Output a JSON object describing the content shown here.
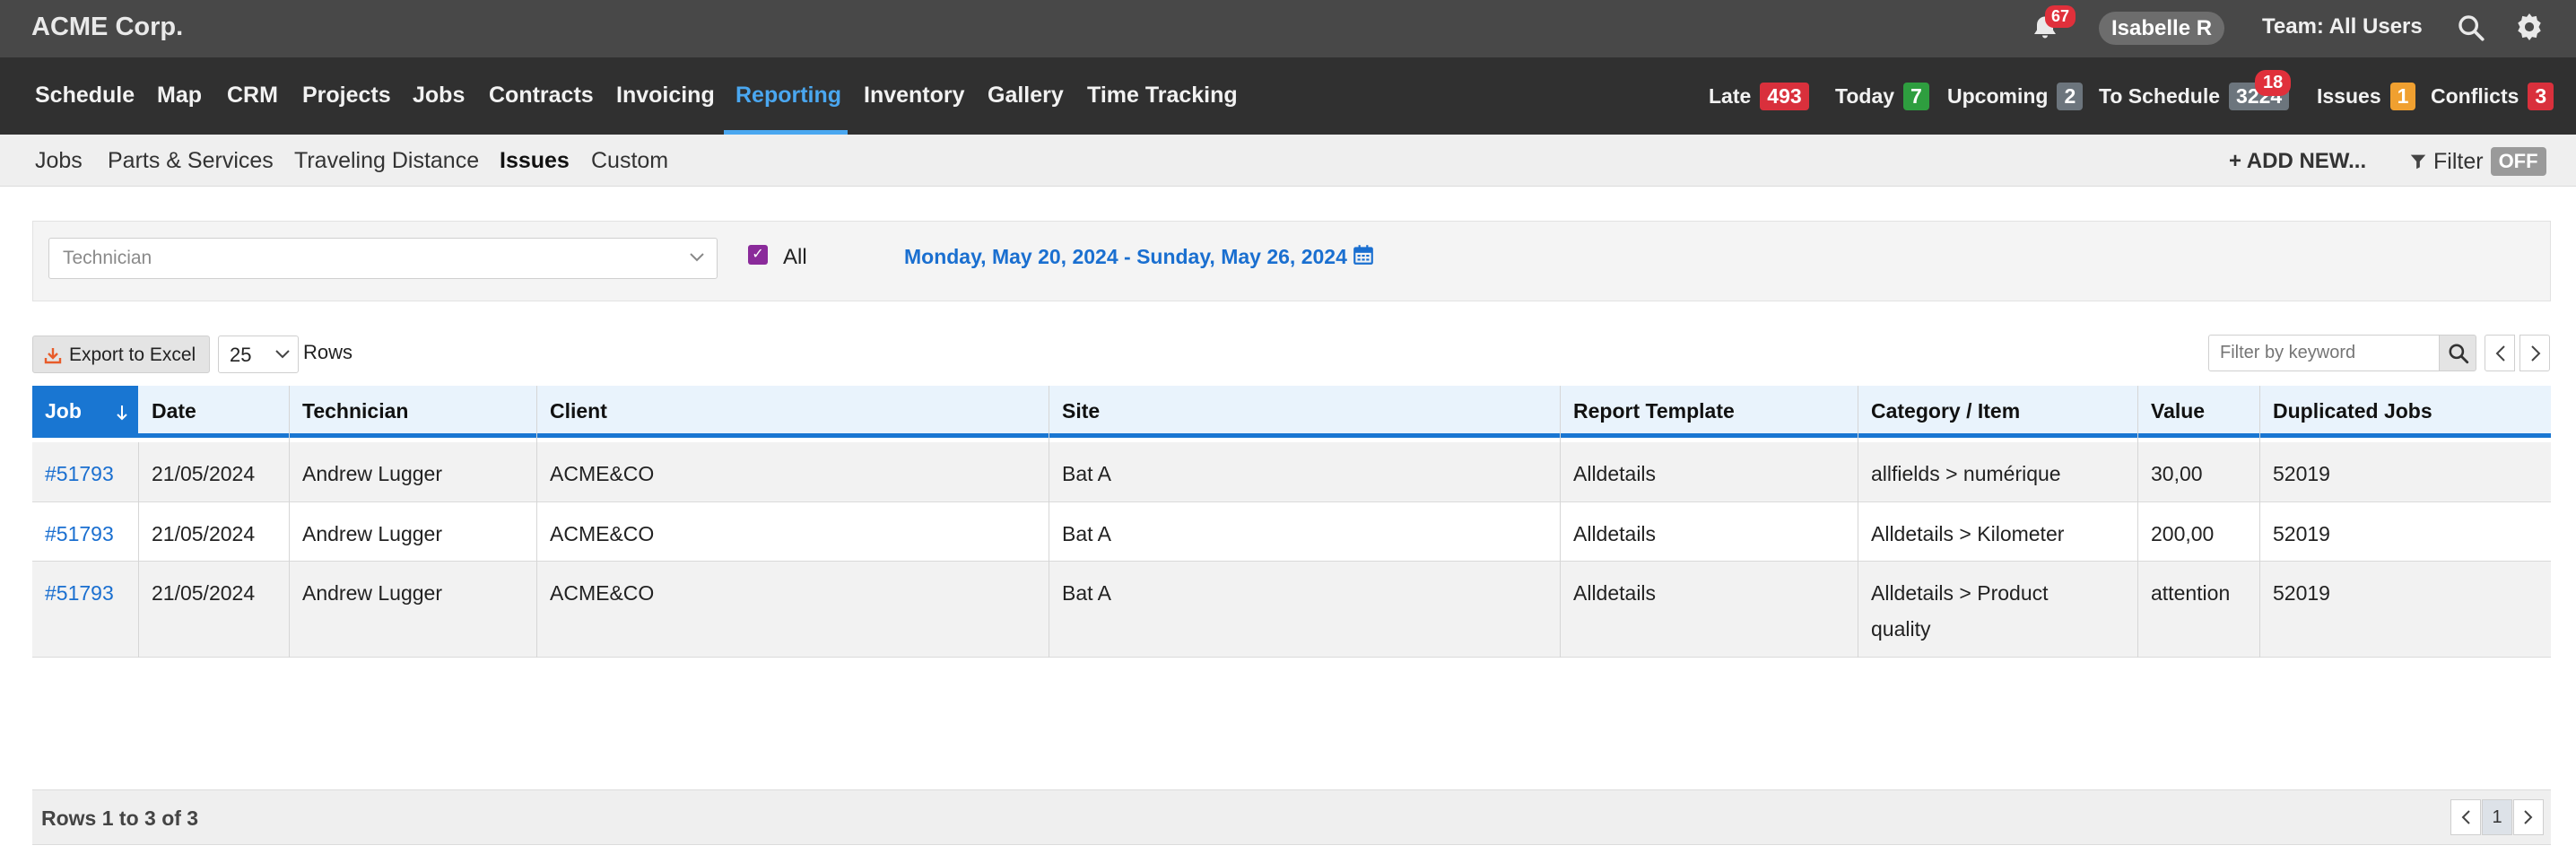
{
  "app": {
    "brand": "ACME Corp."
  },
  "topbar": {
    "notifications_count": "67",
    "user": "Isabelle R",
    "team": "Team: All Users"
  },
  "nav": {
    "items": [
      "Schedule",
      "Map",
      "CRM",
      "Projects",
      "Jobs",
      "Contracts",
      "Invoicing",
      "Reporting",
      "Inventory",
      "Gallery",
      "Time Tracking"
    ],
    "active": "Reporting",
    "stats": [
      {
        "label": "Late",
        "count": "493",
        "color": "#d9303c"
      },
      {
        "label": "Today",
        "count": "7",
        "color": "#2e9e3f"
      },
      {
        "label": "Upcoming",
        "count": "2",
        "color": "#6c757d"
      },
      {
        "label": "To Schedule",
        "count": "3224",
        "color": "#6c757d"
      },
      {
        "label": "Issues",
        "count": "1",
        "color": "#f0a030"
      },
      {
        "label": "Conflicts",
        "count": "3",
        "color": "#d9303c"
      }
    ],
    "to_schedule_badge": "18"
  },
  "subnav": {
    "items": [
      "Jobs",
      "Parts & Services",
      "Traveling Distance",
      "Issues",
      "Custom"
    ],
    "active": "Issues",
    "add_new": "ADD NEW...",
    "filter_label": "Filter",
    "filter_state": "OFF"
  },
  "filters": {
    "technician_placeholder": "Technician",
    "all_label": "All",
    "all_checked": true,
    "date_range": "Monday, May 20, 2024 - Sunday, May 26, 2024"
  },
  "toolbar": {
    "export_label": "Export to Excel",
    "rows_value": "25",
    "rows_label": "Rows",
    "keyword_placeholder": "Filter by keyword"
  },
  "table": {
    "columns": [
      "Job",
      "Date",
      "Technician",
      "Client",
      "Site",
      "Report Template",
      "Category / Item",
      "Value",
      "Duplicated Jobs"
    ],
    "rows": [
      [
        "#51793",
        "21/05/2024",
        "Andrew Lugger",
        "ACME&CO",
        "Bat A",
        "Alldetails",
        "allfields > numérique",
        "30,00",
        "52019"
      ],
      [
        "#51793",
        "21/05/2024",
        "Andrew Lugger",
        "ACME&CO",
        "Bat A",
        "Alldetails",
        "Alldetails > Kilometer",
        "200,00",
        "52019"
      ],
      [
        "#51793",
        "21/05/2024",
        "Andrew Lugger",
        "ACME&CO",
        "Bat A",
        "Alldetails",
        "Alldetails > Product quality",
        "attention",
        "52019"
      ]
    ]
  },
  "footer": {
    "summary": "Rows 1 to 3 of 3",
    "current_page": "1"
  },
  "colors": {
    "accent": "#1976d2",
    "link": "#1a6fd0",
    "nav_active": "#4aa7f0"
  }
}
